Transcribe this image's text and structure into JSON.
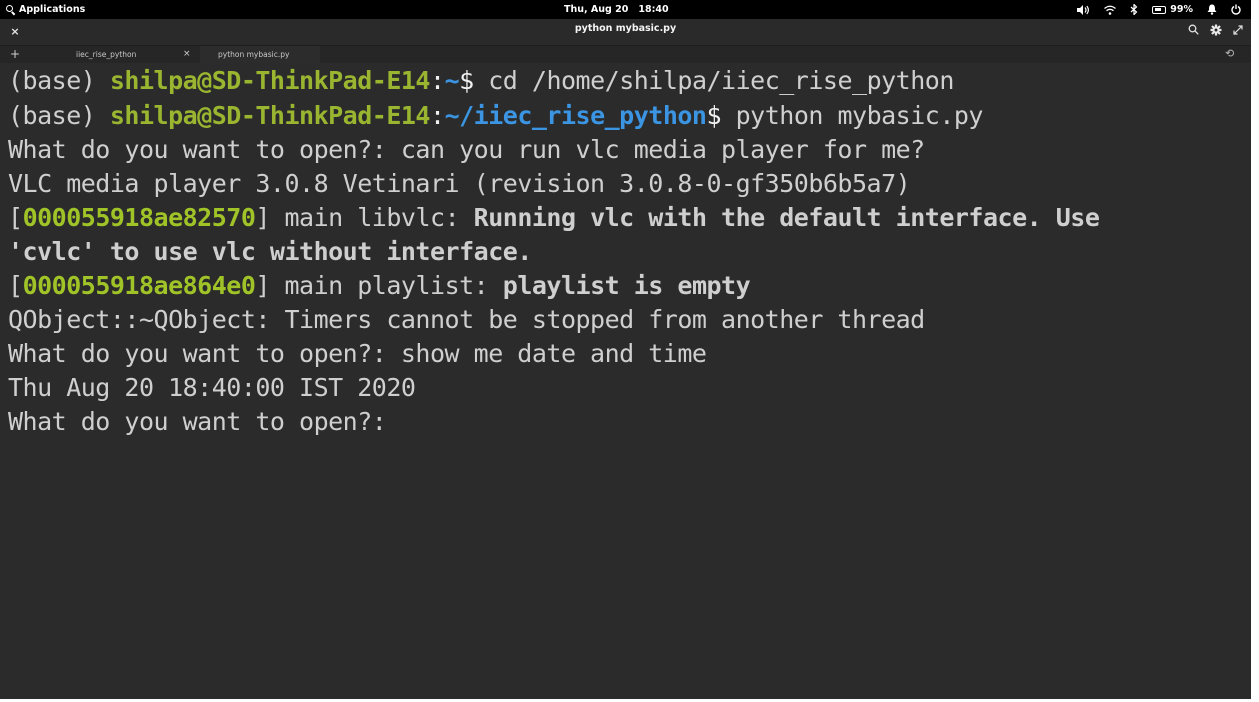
{
  "top_panel": {
    "applications_label": "Applications",
    "date": "Thu, Aug 20",
    "time": "18:40",
    "battery_percent": "99%",
    "icons": [
      "search-icon",
      "volume-icon",
      "wifi-icon",
      "bluetooth-icon",
      "battery-icon",
      "notifications-icon",
      "power-icon"
    ]
  },
  "window": {
    "title": "python mybasic.py",
    "close_glyph": "×",
    "tools": [
      "search-icon",
      "settings-icon",
      "fullscreen-icon"
    ]
  },
  "tabs": {
    "new_tab_glyph": "+",
    "items": [
      {
        "label": "iiec_rise_python",
        "close_glyph": "×"
      },
      {
        "label": "python mybasic.py"
      }
    ],
    "history_glyph": "⟲"
  },
  "terminal": {
    "line1": {
      "env": "(base) ",
      "userhost": "shilpa@SD-ThinkPad-E14",
      "sep": ":",
      "path": "~",
      "prompt": "$ ",
      "command": "cd /home/shilpa/iiec_rise_python"
    },
    "line2": {
      "env": "(base) ",
      "userhost": "shilpa@SD-ThinkPad-E14",
      "sep": ":",
      "path": "~/iiec_rise_python",
      "prompt": "$ ",
      "command": "python mybasic.py"
    },
    "line3": "What do you want to open?: can you run vlc media player for me?",
    "line4": "VLC media player 3.0.8 Vetinari (revision 3.0.8-0-gf350b6b5a7)",
    "line5": {
      "open": "[",
      "id": "000055918ae82570",
      "close": "]",
      "module": " main libvlc: ",
      "message": "Running vlc with the default interface. Use"
    },
    "line6": "'cvlc' to use vlc without interface.",
    "line7": {
      "open": "[",
      "id": "000055918ae864e0",
      "close": "]",
      "module": " main playlist: ",
      "message": "playlist is empty"
    },
    "line8": "QObject::~QObject: Timers cannot be stopped from another thread",
    "line9": "What do you want to open?: show me date and time",
    "line10": "Thu Aug 20 18:40:00 IST 2020",
    "line11": "What do you want to open?: "
  },
  "colors": {
    "terminal_bg": "#2b2b2b",
    "text": "#cfcfcf",
    "userhost_green": "#9ab530",
    "path_blue": "#3b95e2",
    "id_green": "#a0c428",
    "panel_bg": "#000000"
  }
}
